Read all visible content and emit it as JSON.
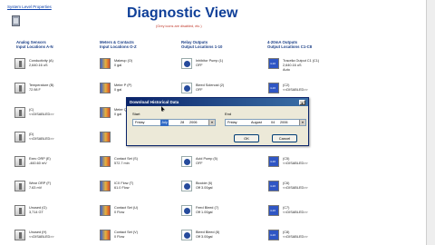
{
  "page": {
    "system_link": "System Level Properties",
    "title": "Diagnostic View",
    "subtitle": "(Grey icons are disabled, etc.)"
  },
  "columns": [
    {
      "line1": "Analog Sensors",
      "line2": "Input Locations A-N"
    },
    {
      "line1": "Meters & Contacts",
      "line2": "Input Locations O-Z"
    },
    {
      "line1": "Relay Outputs",
      "line2": "Output Locations 1-10"
    },
    {
      "line1": "4-20mA Outputs",
      "line2": "Output Locations C1-C8"
    }
  ],
  "analog": [
    {
      "name": "Conductivity (A)",
      "value": "2,640.16 uS"
    },
    {
      "name": "Temperature (B)",
      "value": "72.98 F"
    },
    {
      "name": "(C)",
      "value": "<<DISABLED>>"
    },
    {
      "name": "(D)",
      "value": "<<DISABLED>>"
    },
    {
      "name": "Exec ORP (E)",
      "value": "-460.60 mV"
    },
    {
      "name": "Wear ORP (F)",
      "value": "7.63 mV"
    },
    {
      "name": "Unused (G)",
      "value": "3,714 GT"
    },
    {
      "name": "Unused (H)",
      "value": "<<DISABLED>>"
    }
  ],
  "meters": [
    {
      "name": "Makeup (O)",
      "value": "0 gal"
    },
    {
      "name": "Meter P (P)",
      "value": "0 gal"
    },
    {
      "name": "Meter Q (Q)",
      "value": "0 gal"
    },
    {
      "name": "",
      "value": ""
    },
    {
      "name": "Contact Set (S)",
      "value": "572.7 min"
    },
    {
      "name": "ICX Flow (T)",
      "value": "61.0 Flow"
    },
    {
      "name": "Contact Set (U)",
      "value": "0 Flow"
    },
    {
      "name": "Contact Set (V)",
      "value": "0 Flow"
    }
  ],
  "relays": [
    {
      "name": "Inhibitor Pump (1)",
      "value": "OFF"
    },
    {
      "name": "Bleed Solenoid (2)",
      "value": "OFF"
    },
    {
      "name": "",
      "value": ""
    },
    {
      "name": "",
      "value": ""
    },
    {
      "name": "Acid Pump (5)",
      "value": "OFF"
    },
    {
      "name": "Biocide (6)",
      "value": "Off 3.00gal"
    },
    {
      "name": "Feed Bleed (7)",
      "value": "Off 1.00gal"
    },
    {
      "name": "Bleed Bleed (8)",
      "value": "Off 3.00gal"
    }
  ],
  "outputs": [
    {
      "name": "Tracelia Output C1 (C1)",
      "value": "2,640.16 uS",
      "extra": "Auto"
    },
    {
      "name": "(C2)",
      "value": "<<DISABLED>>",
      "extra": ""
    },
    {
      "name": "(C3)",
      "value": "<<DISABLED>>",
      "extra": ""
    },
    {
      "name": "(C4)",
      "value": "<<DISABLED>>",
      "extra": ""
    },
    {
      "name": "(C5)",
      "value": "<<DISABLED>>",
      "extra": ""
    },
    {
      "name": "(C6)",
      "value": "<<DISABLED>>",
      "extra": ""
    },
    {
      "name": "(C7)",
      "value": "<<DISABLED>>",
      "extra": ""
    },
    {
      "name": "(C8)",
      "value": "<<DISABLED>>",
      "extra": ""
    }
  ],
  "dialog": {
    "title": "Download Historical Data",
    "start_label": "Start",
    "end_label": "End",
    "start": {
      "weekday": "Friday",
      "month": "July",
      "day": "28",
      "year": "2006"
    },
    "end": {
      "weekday": "Friday",
      "month": "August",
      "day": "04",
      "year": "2006"
    },
    "ok": "OK",
    "cancel": "Cancel",
    "close": "x"
  }
}
